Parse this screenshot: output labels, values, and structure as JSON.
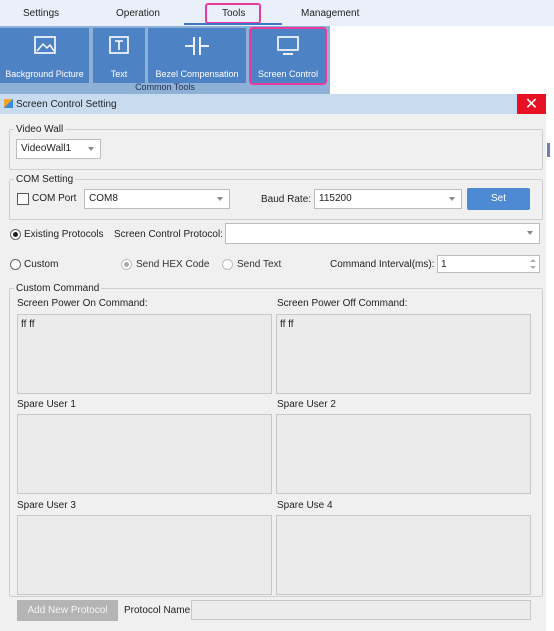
{
  "menu": {
    "settings": "Settings",
    "operation": "Operation",
    "tools": "Tools",
    "management": "Management"
  },
  "ribbon": {
    "buttons": {
      "background_picture": "Background Picture",
      "text": "Text",
      "bezel_compensation": "Bezel Compensation",
      "screen_control": "Screen Control"
    },
    "group_label": "Common Tools",
    "accent_color": "#4d82c4",
    "highlight_color": "#e93aa0"
  },
  "dialog": {
    "title": "Screen Control Setting",
    "close_glyph": "✕",
    "video_wall": {
      "legend": "Video Wall",
      "value": "VideoWall1"
    },
    "com": {
      "legend": "COM Setting",
      "com_port_label": "COM Port",
      "com_port_value": "COM8",
      "baud_label": "Baud Rate:",
      "baud_value": "115200",
      "set_label": "Set"
    },
    "existing_protocols_label": "Existing Protocols",
    "protocol_label": "Screen Control Protocol:",
    "protocol_value": "",
    "custom_label": "Custom",
    "send_hex_label": "Send HEX Code",
    "send_text_label": "Send Text",
    "interval_label": "Command Interval(ms):",
    "interval_value": "1",
    "custom_command": {
      "legend": "Custom Command",
      "power_on_label": "Screen Power On Command:",
      "power_on_value": "ff ff",
      "power_off_label": "Screen Power Off Command:",
      "power_off_value": "ff ff",
      "spare1_label": "Spare User 1",
      "spare2_label": "Spare User 2",
      "spare3_label": "Spare User 3",
      "spare4_label": "Spare Use 4"
    },
    "add_protocol_label": "Add New Protocol",
    "protocol_name_label": "Protocol Name:",
    "protocol_name_value": ""
  }
}
